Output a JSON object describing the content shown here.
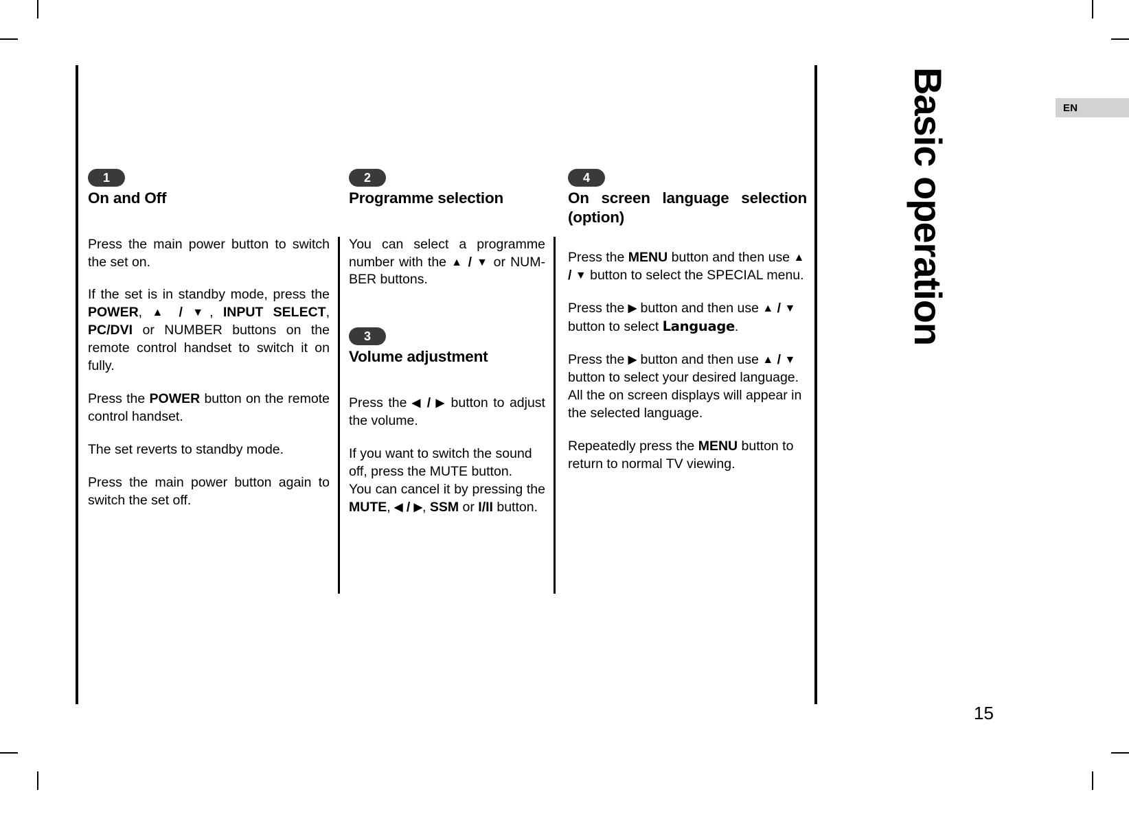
{
  "page": {
    "running_head": "Basic operation",
    "language_badge": "EN",
    "page_number": "15"
  },
  "sections": [
    {
      "badge": "1",
      "title": "On and Off",
      "paragraphs": [
        "Press the main power button to switch the set on.",
        "If the set is in standby mode, press the POWER, ▲ / ▼, INPUT SELECT, PC/DVI or NUMBER buttons on the remote control handset to switch it on fully.",
        "Press the POWER button on the remote control handset.",
        "The set reverts to standby mode.",
        "Press the main power button again to switch the set off."
      ]
    },
    {
      "badge": "2",
      "title": "Programme selection",
      "paragraphs": [
        "You can select a programme number with the ▲ / ▼ or NUM-BER buttons."
      ]
    },
    {
      "badge": "3",
      "title": "Volume adjustment",
      "paragraphs": [
        "Press the ◀ / ▶ button to adjust the volume.",
        "If you want to switch the sound off, press the MUTE button.",
        "You can cancel it by pressing the MUTE, ◀ / ▶, SSM or I/II button."
      ]
    },
    {
      "badge": "4",
      "title_line1": "On screen language selection",
      "title_line2": "(option)",
      "paragraphs": [
        "Press the MENU button and then use ▲ / ▼ button to select the SPECIAL menu.",
        "Press the ▶ button and then use ▲ / ▼ button to select Language.",
        "Press the ▶ button and then use ▲ / ▼ button to select your desired language. All the on screen displays will appear in the selected language.",
        "Repeatedly press the MENU button to return to normal TV viewing."
      ]
    }
  ],
  "text": {
    "c1p1": "Press the main power button to switch the set on.",
    "c1p2_a": "If the set is in standby mode, press the ",
    "c1p2_power": "POWER",
    "c1p2_comma1": ", ",
    "c1p2_up": "▲",
    "c1p2_slash": " / ",
    "c1p2_down": "▼",
    "c1p2_comma2": ", ",
    "c1p2_input": "INPUT SELECT",
    "c1p2_comma3": ", ",
    "c1p2_pcdvi": "PC/DVI",
    "c1p2_b": " or NUMBER buttons on the remote control handset to switch it on fully.",
    "c1p3_a": "Press the ",
    "c1p3_power": "POWER",
    "c1p3_b": " button on the remote control handset.",
    "c1p4": "The set reverts to standby mode.",
    "c1p5": "Press the main power button again to switch the set off.",
    "c2p1_a": "You can select a programme number with the ",
    "c2p1_up": "▲",
    "c2p1_slash": " / ",
    "c2p1_down": "▼",
    "c2p1_b": " or NUM-BER buttons.",
    "c3p1_a": "Press the ",
    "c3p1_left": "◀",
    "c3p1_slash": " / ",
    "c3p1_right": "▶",
    "c3p1_b": " button to adjust the volume.",
    "c3p2": "If you want to switch the sound off, press the MUTE button.",
    "c3p3_a": "You can cancel it by pressing the ",
    "c3p3_mute": "MUTE",
    "c3p3_c1": ", ",
    "c3p3_left": "◀",
    "c3p3_slash": " / ",
    "c3p3_right": "▶",
    "c3p3_c2": ", ",
    "c3p3_ssm": "SSM",
    "c3p3_or": " or ",
    "c3p3_iii": "I/II",
    "c3p3_b": " button.",
    "c4p1_a": "Press the ",
    "c4p1_menu": "MENU",
    "c4p1_b": " button and then use ",
    "c4p1_up": "▲",
    "c4p1_slash": " / ",
    "c4p1_down": "▼",
    "c4p1_c": " button to select the SPECIAL menu.",
    "c4p2_a": "Press the ",
    "c4p2_right": "▶",
    "c4p2_b": " button and then use ",
    "c4p2_up": "▲",
    "c4p2_slash": " / ",
    "c4p2_down": "▼",
    "c4p2_c": " button to select ",
    "c4p2_lang": "Language",
    "c4p2_d": ".",
    "c4p3_a": "Press the ",
    "c4p3_right": "▶",
    "c4p3_b": " button and then use ",
    "c4p3_up": "▲",
    "c4p3_slash": " / ",
    "c4p3_down": "▼",
    "c4p3_c": " button to select your desired language.",
    "c4p3_d": "All the on screen displays will appear in the selected language.",
    "c4p4_a": "Repeatedly press the ",
    "c4p4_menu": "MENU",
    "c4p4_b": " button to return to normal TV viewing."
  }
}
